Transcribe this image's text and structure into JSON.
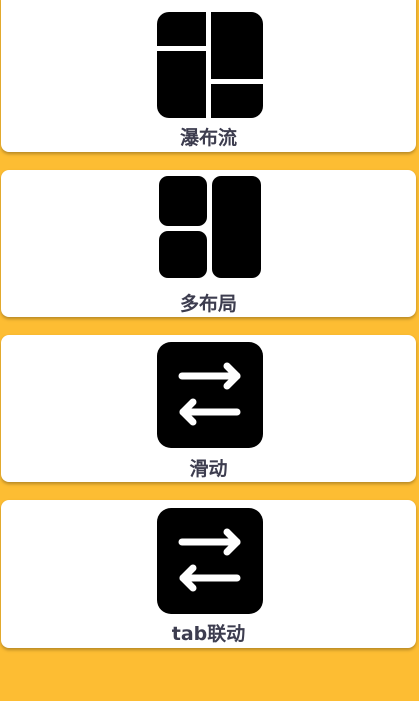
{
  "background_color": "#fdbd33",
  "cards": [
    {
      "label": "瀑布流",
      "icon": "waterfall-layout-icon"
    },
    {
      "label": "多布局",
      "icon": "multi-layout-icon"
    },
    {
      "label": "滑动",
      "icon": "swap-arrows-icon"
    },
    {
      "label": "tab联动",
      "icon": "swap-arrows-icon"
    }
  ]
}
